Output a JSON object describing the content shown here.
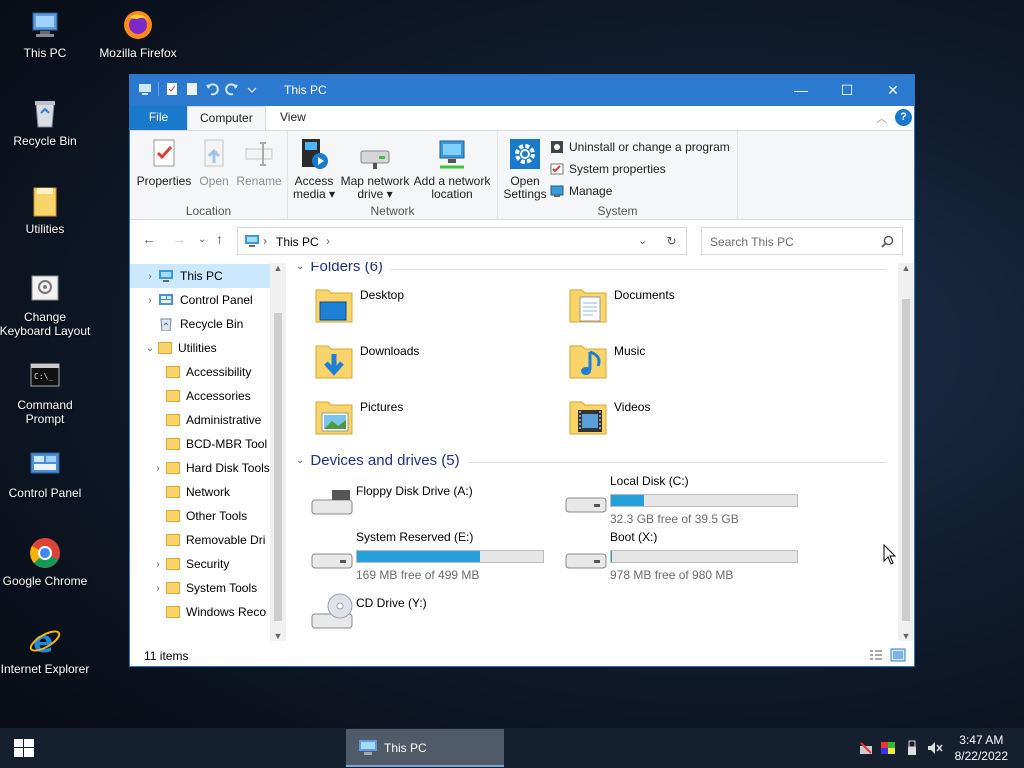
{
  "desktop": {
    "icons": [
      {
        "label": "This PC",
        "icon": "computer-icon"
      },
      {
        "label": "Mozilla Firefox",
        "icon": "firefox-icon"
      },
      {
        "label": "Recycle Bin",
        "icon": "recycle-bin-icon"
      },
      {
        "label": "Utilities",
        "icon": "folder-icon"
      },
      {
        "label": "Change Keyboard Layout",
        "icon": "keyboard-icon"
      },
      {
        "label": "Command Prompt",
        "icon": "terminal-icon"
      },
      {
        "label": "Control Panel",
        "icon": "control-panel-icon"
      },
      {
        "label": "Google Chrome",
        "icon": "chrome-icon"
      },
      {
        "label": "Internet Explorer",
        "icon": "ie-icon"
      }
    ]
  },
  "window": {
    "title": "This PC",
    "controls": {
      "minimize": "—",
      "maximize": "☐",
      "close": "✕"
    },
    "ribbon_tabs": [
      "File",
      "Computer",
      "View"
    ],
    "ribbon": {
      "location": {
        "label": "Location",
        "buttons": [
          "Properties",
          "Open",
          "Rename"
        ]
      },
      "network": {
        "label": "Network",
        "access_media": [
          "Access",
          "media ▾"
        ],
        "map_drive": [
          "Map network",
          "drive ▾"
        ],
        "add_location": [
          "Add a network",
          "location"
        ]
      },
      "system": {
        "label": "System",
        "open_settings": [
          "Open",
          "Settings"
        ],
        "small": [
          "Uninstall or change a program",
          "System properties",
          "Manage"
        ]
      }
    },
    "address": {
      "path": "This PC",
      "search_placeholder": "Search This PC"
    },
    "nav_pane": [
      {
        "label": "This PC",
        "selected": true,
        "expander": "›",
        "icon": "computer-icon"
      },
      {
        "label": "Control Panel",
        "expander": "›",
        "icon": "control-panel-icon"
      },
      {
        "label": "Recycle Bin",
        "expander": "",
        "icon": "recycle-bin-icon"
      },
      {
        "label": "Utilities",
        "expander": "⌄",
        "icon": "folder-icon"
      },
      {
        "label": "Accessibility",
        "expander": "",
        "icon": "folder-icon"
      },
      {
        "label": "Accessories",
        "expander": "",
        "icon": "folder-icon"
      },
      {
        "label": "Administrative",
        "expander": "",
        "icon": "folder-icon"
      },
      {
        "label": "BCD-MBR Tool",
        "expander": "",
        "icon": "folder-icon"
      },
      {
        "label": "Hard Disk Tools",
        "expander": "›",
        "icon": "folder-icon"
      },
      {
        "label": "Network",
        "expander": "",
        "icon": "folder-icon"
      },
      {
        "label": "Other Tools",
        "expander": "",
        "icon": "folder-icon"
      },
      {
        "label": "Removable Dri",
        "expander": "",
        "icon": "folder-icon"
      },
      {
        "label": "Security",
        "expander": "›",
        "icon": "folder-icon"
      },
      {
        "label": "System Tools",
        "expander": "›",
        "icon": "folder-icon"
      },
      {
        "label": "Windows Reco",
        "expander": "",
        "icon": "folder-icon"
      }
    ],
    "folders_header": "Folders (6)",
    "folders": [
      "Desktop",
      "Documents",
      "Downloads",
      "Music",
      "Pictures",
      "Videos"
    ],
    "drives_header": "Devices and drives (5)",
    "drives": [
      {
        "name": "Floppy Disk Drive (A:)",
        "free_text": "",
        "used_fraction": null
      },
      {
        "name": "Local Disk (C:)",
        "free_text": "32.3 GB free of 39.5 GB",
        "used_fraction": 0.18
      },
      {
        "name": "System Reserved (E:)",
        "free_text": "169 MB free of 499 MB",
        "used_fraction": 0.66
      },
      {
        "name": "Boot (X:)",
        "free_text": "978 MB free of 980 MB",
        "used_fraction": 0.002
      },
      {
        "name": "CD Drive (Y:)",
        "free_text": "",
        "used_fraction": null
      }
    ],
    "status": "11 items"
  },
  "taskbar": {
    "active_item": "This PC",
    "time": "3:47 AM",
    "date": "8/22/2022"
  },
  "colors": {
    "accent": "#2b7ad0",
    "selection": "#cce8ff",
    "progress": "#26a0da"
  }
}
